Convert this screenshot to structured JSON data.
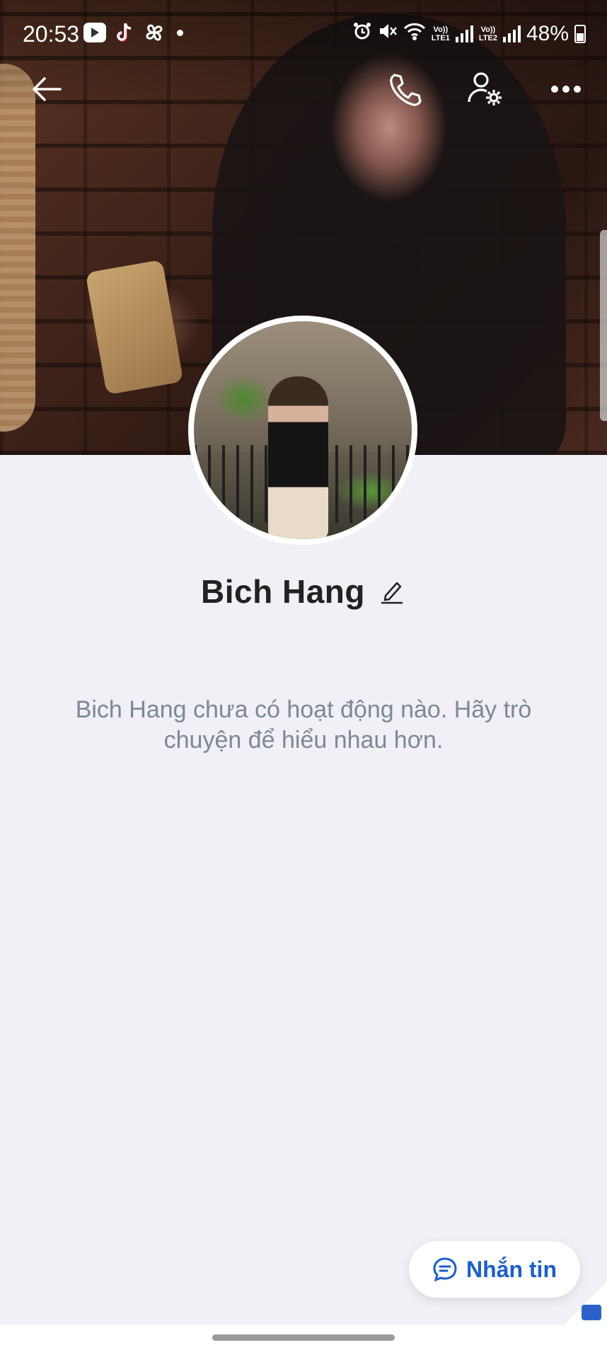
{
  "status_bar": {
    "time": "20:53",
    "app_icons": [
      "youtube-icon",
      "tiktok-icon",
      "pinwheel-icon"
    ],
    "battery_percent": "48%",
    "sim1_label": "Vo))\nLTE1",
    "sim2_label": "Vo))\nLTE2"
  },
  "top_bar": {
    "icons": [
      "back-arrow-icon",
      "phone-icon",
      "user-settings-icon",
      "more-options-icon"
    ]
  },
  "profile": {
    "name": "Bich Hang",
    "empty_activity_message": "Bich Hang chưa có hoạt động nào. Hãy trò chuyện để hiểu nhau hơn."
  },
  "actions": {
    "message_button_label": "Nhắn tin"
  },
  "colors": {
    "background": "#f0f0f6",
    "accent_blue": "#1a5fcf",
    "name_text": "#222222",
    "muted_text": "#7d8894"
  }
}
